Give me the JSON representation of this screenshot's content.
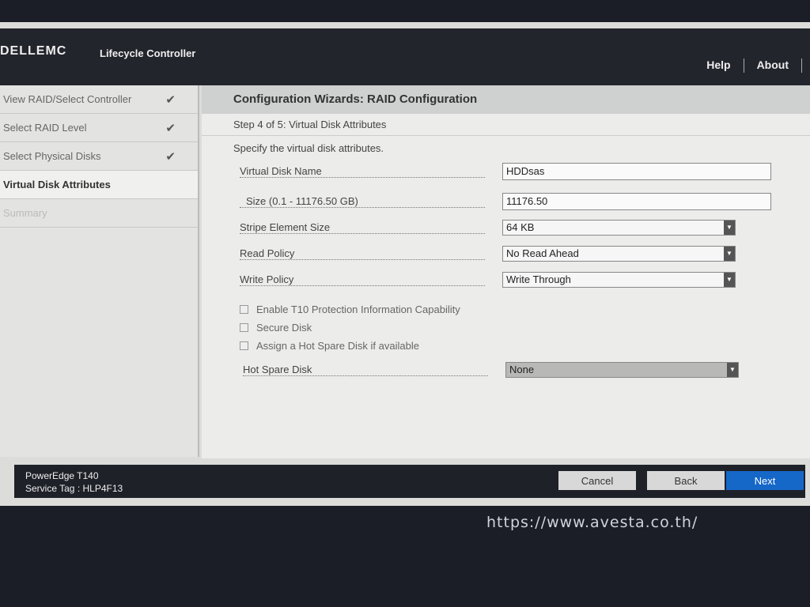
{
  "header": {
    "logo": "DELLEMC",
    "product": "Lifecycle Controller",
    "help": "Help",
    "about": "About"
  },
  "steps": [
    {
      "label": "View RAID/Select Controller",
      "done": true
    },
    {
      "label": "Select RAID Level",
      "done": true
    },
    {
      "label": "Select Physical Disks",
      "done": true
    },
    {
      "label": "Virtual Disk Attributes",
      "done": false
    },
    {
      "label": "Summary",
      "done": false
    }
  ],
  "check_glyph": "✔",
  "main": {
    "title": "Configuration Wizards: RAID Configuration",
    "step": "Step 4 of 5: Virtual Disk Attributes",
    "desc": "Specify the virtual disk attributes.",
    "vd_name_label": "Virtual Disk Name",
    "vd_name": "HDDsas",
    "size_label": "Size (0.1 - 11176.50 GB)",
    "size": "11176.50",
    "stripe_label": "Stripe Element Size",
    "stripe": "64 KB",
    "read_label": "Read Policy",
    "read": "No Read Ahead",
    "write_label": "Write Policy",
    "write": "Write Through",
    "t10": "Enable T10 Protection Information Capability",
    "secure": "Secure Disk",
    "hotspare_auto": "Assign a Hot Spare Disk if available",
    "hotspare_label": "Hot Spare Disk",
    "hotspare": "None"
  },
  "footer": {
    "model": "PowerEdge T140",
    "service_tag": "Service Tag : HLP4F13",
    "cancel": "Cancel",
    "back": "Back",
    "next": "Next"
  },
  "watermark": "https://www.avesta.co.th/"
}
